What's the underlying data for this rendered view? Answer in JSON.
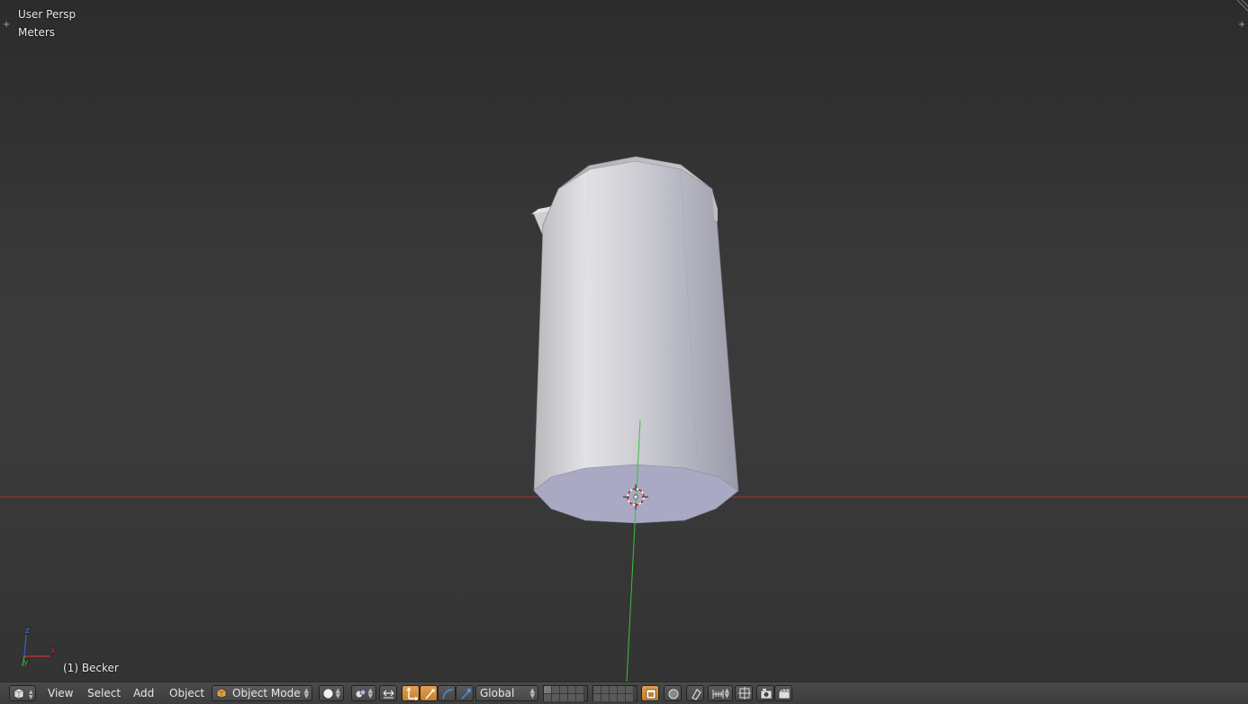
{
  "viewport": {
    "view_name": "User Persp",
    "units": "Meters",
    "object_label": "(1) Becker",
    "axis_labels": {
      "x": "x",
      "y": "y",
      "z": "z"
    }
  },
  "header": {
    "editor_type_icon": "3d-view-cube-icon",
    "menus": [
      "View",
      "Select",
      "Add",
      "Object"
    ],
    "mode": {
      "label": "Object Mode",
      "icon": "object-cube-icon"
    },
    "shading_icon": "solid-sphere-icon",
    "pivot_icon": "pivot-point-icon",
    "manipulator_icons": [
      "manipulator-toggle-icon",
      "translate-icon",
      "rotate-icon",
      "scale-icon"
    ],
    "orientation": "Global",
    "snap_icons": [
      "lock-camera-icon",
      "snap-icon",
      "proportional-edit-icon"
    ],
    "render_icons": [
      "render-still-icon",
      "render-animation-icon"
    ]
  },
  "colors": {
    "x_axis": "#c03030",
    "y_axis": "#3cbf3c",
    "active_button": "#d18d3b",
    "viewport_bg": "#393939"
  }
}
